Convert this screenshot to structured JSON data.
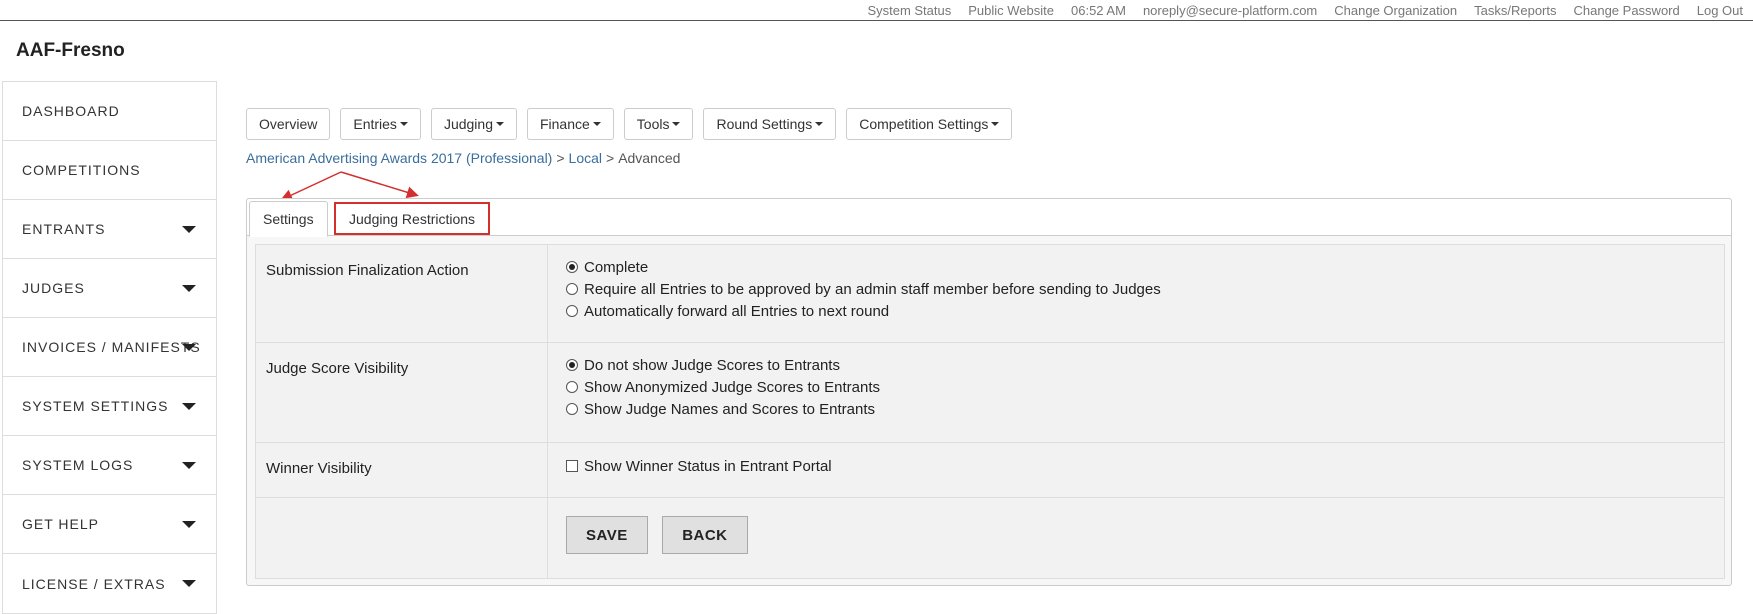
{
  "topbar": {
    "links": [
      "System Status",
      "Public Website"
    ],
    "time": "06:52 AM",
    "email": "noreply@secure-platform.com",
    "right_links": [
      "Change Organization",
      "Tasks/Reports",
      "Change Password",
      "Log Out"
    ]
  },
  "org_title": "AAF-Fresno",
  "sidebar": {
    "items": [
      {
        "label": "DASHBOARD",
        "has_caret": false
      },
      {
        "label": "COMPETITIONS",
        "has_caret": false
      },
      {
        "label": "ENTRANTS",
        "has_caret": true
      },
      {
        "label": "JUDGES",
        "has_caret": true
      },
      {
        "label": "INVOICES / MANIFESTS",
        "has_caret": true
      },
      {
        "label": "SYSTEM SETTINGS",
        "has_caret": true
      },
      {
        "label": "SYSTEM LOGS",
        "has_caret": true
      },
      {
        "label": "GET HELP",
        "has_caret": true
      },
      {
        "label": "LICENSE / EXTRAS",
        "has_caret": true
      }
    ]
  },
  "nav": {
    "buttons": [
      {
        "label": "Overview",
        "dropdown": false
      },
      {
        "label": "Entries",
        "dropdown": true
      },
      {
        "label": "Judging",
        "dropdown": true
      },
      {
        "label": "Finance",
        "dropdown": true
      },
      {
        "label": "Tools",
        "dropdown": true
      },
      {
        "label": "Round Settings",
        "dropdown": true
      },
      {
        "label": "Competition Settings",
        "dropdown": true
      }
    ]
  },
  "breadcrumb": {
    "competition": "American Advertising Awards 2017 (Professional)",
    "round": "Local",
    "current": "Advanced",
    "separator": ">"
  },
  "tabs": {
    "settings": "Settings",
    "judging_restrictions": "Judging Restrictions"
  },
  "form": {
    "submission": {
      "label": "Submission Finalization Action",
      "options": [
        {
          "text": "Complete",
          "selected": true
        },
        {
          "text": "Require all Entries to be approved by an admin staff member before sending to Judges",
          "selected": false
        },
        {
          "text": "Automatically forward all Entries to next round",
          "selected": false
        }
      ]
    },
    "judge_score": {
      "label": "Judge Score Visibility",
      "options": [
        {
          "text": "Do not show Judge Scores to Entrants",
          "selected": true
        },
        {
          "text": "Show Anonymized Judge Scores to Entrants",
          "selected": false
        },
        {
          "text": "Show Judge Names and Scores to Entrants",
          "selected": false
        }
      ]
    },
    "winner": {
      "label": "Winner Visibility",
      "checkbox_text": "Show Winner Status in Entrant Portal",
      "checked": false
    },
    "save_label": "SAVE",
    "back_label": "BACK"
  },
  "colors": {
    "link": "#3a6e9c",
    "annotation": "#d32f2f",
    "panel_bg": "#f7f7f7"
  }
}
